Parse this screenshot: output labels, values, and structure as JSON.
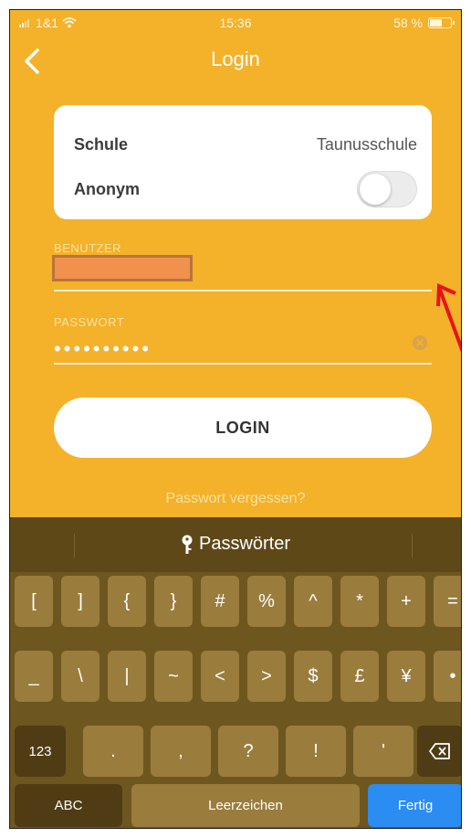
{
  "status_bar": {
    "carrier": "1&1",
    "time": "15:36",
    "battery": "58 %",
    "battery_level": 0.58
  },
  "nav": {
    "title": "Login"
  },
  "card": {
    "school_label": "Schule",
    "school_value": "Taunusschule",
    "anonymous_label": "Anonym",
    "anonymous_on": false
  },
  "username": {
    "label": "BENUTZER"
  },
  "password": {
    "label": "PASSWORT",
    "masked_value": "••••••••••"
  },
  "login_button": "LOGIN",
  "forgot_link": "Passwort vergessen?",
  "keyboard": {
    "suggestion": "Passwörter",
    "row1": [
      "[",
      "]",
      "{",
      "}",
      "#",
      "%",
      "^",
      "*",
      "+",
      "="
    ],
    "row2": [
      "_",
      "\\",
      "|",
      "~",
      "<",
      ">",
      "$",
      "£",
      "¥",
      "•"
    ],
    "row3": [
      ".",
      ",",
      "?",
      "!",
      "'"
    ],
    "mode_key": "123",
    "abc_key": "ABC",
    "space_key": "Leerzeichen",
    "done_key": "Fertig"
  },
  "colors": {
    "accent": "#f4b12a",
    "keyboard": "#6e561f",
    "done": "#2b8df2",
    "annotation_arrow": "#e8141b"
  }
}
